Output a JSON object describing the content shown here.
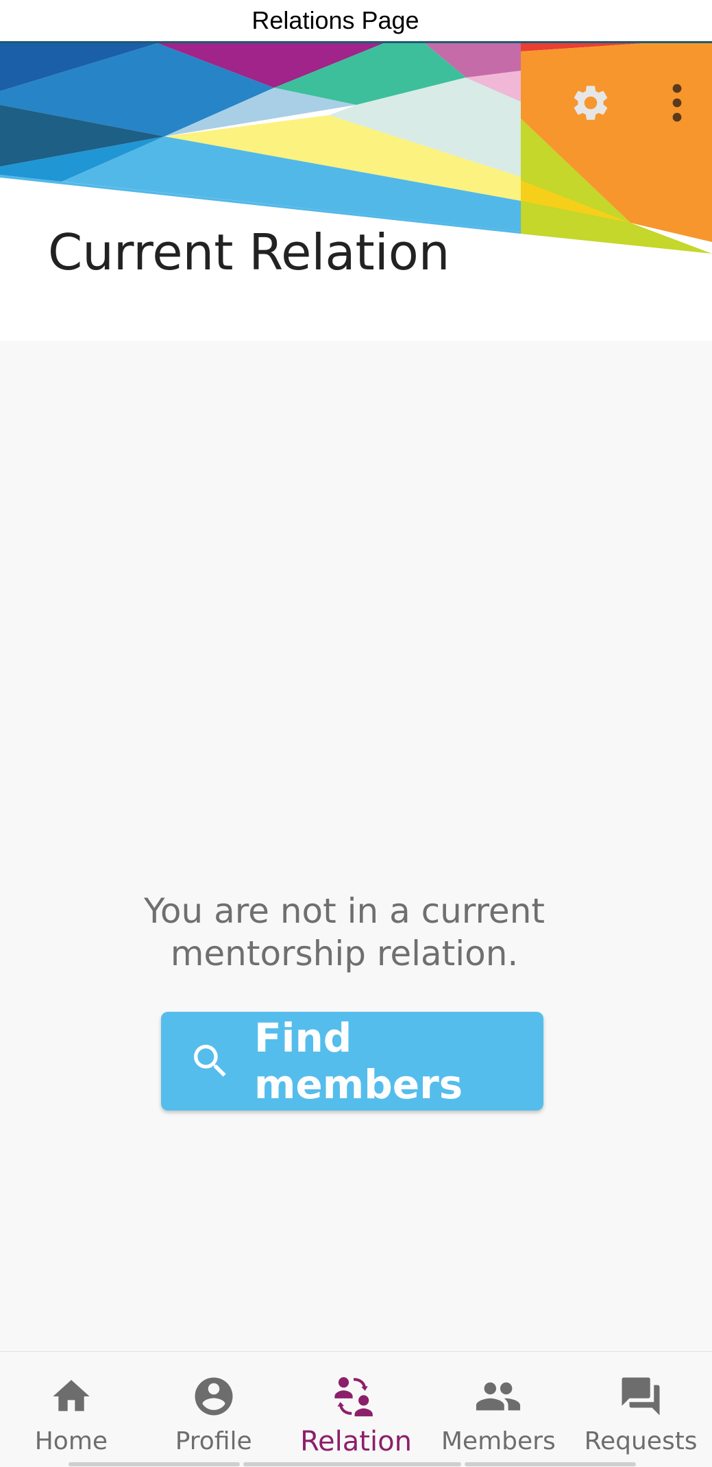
{
  "window": {
    "title": "Relations Page"
  },
  "header": {
    "settings_icon": "gear-icon",
    "more_icon": "more-vert-icon",
    "heading": "Current Relation"
  },
  "main": {
    "empty_message": "You are not in a current mentorship relation.",
    "find_button": {
      "label": "Find members",
      "icon": "search-icon"
    }
  },
  "bottom_nav": {
    "items": [
      {
        "label": "Home",
        "icon": "home-icon",
        "active": false
      },
      {
        "label": "Profile",
        "icon": "account-circle-icon",
        "active": false
      },
      {
        "label": "Relation",
        "icon": "relation-swap-icon",
        "active": true
      },
      {
        "label": "Members",
        "icon": "people-icon",
        "active": false
      },
      {
        "label": "Requests",
        "icon": "forum-icon",
        "active": false
      }
    ]
  },
  "colors": {
    "accent": "#8c1f6a",
    "button": "#55bdec",
    "nav_inactive": "#6d6d6d"
  }
}
